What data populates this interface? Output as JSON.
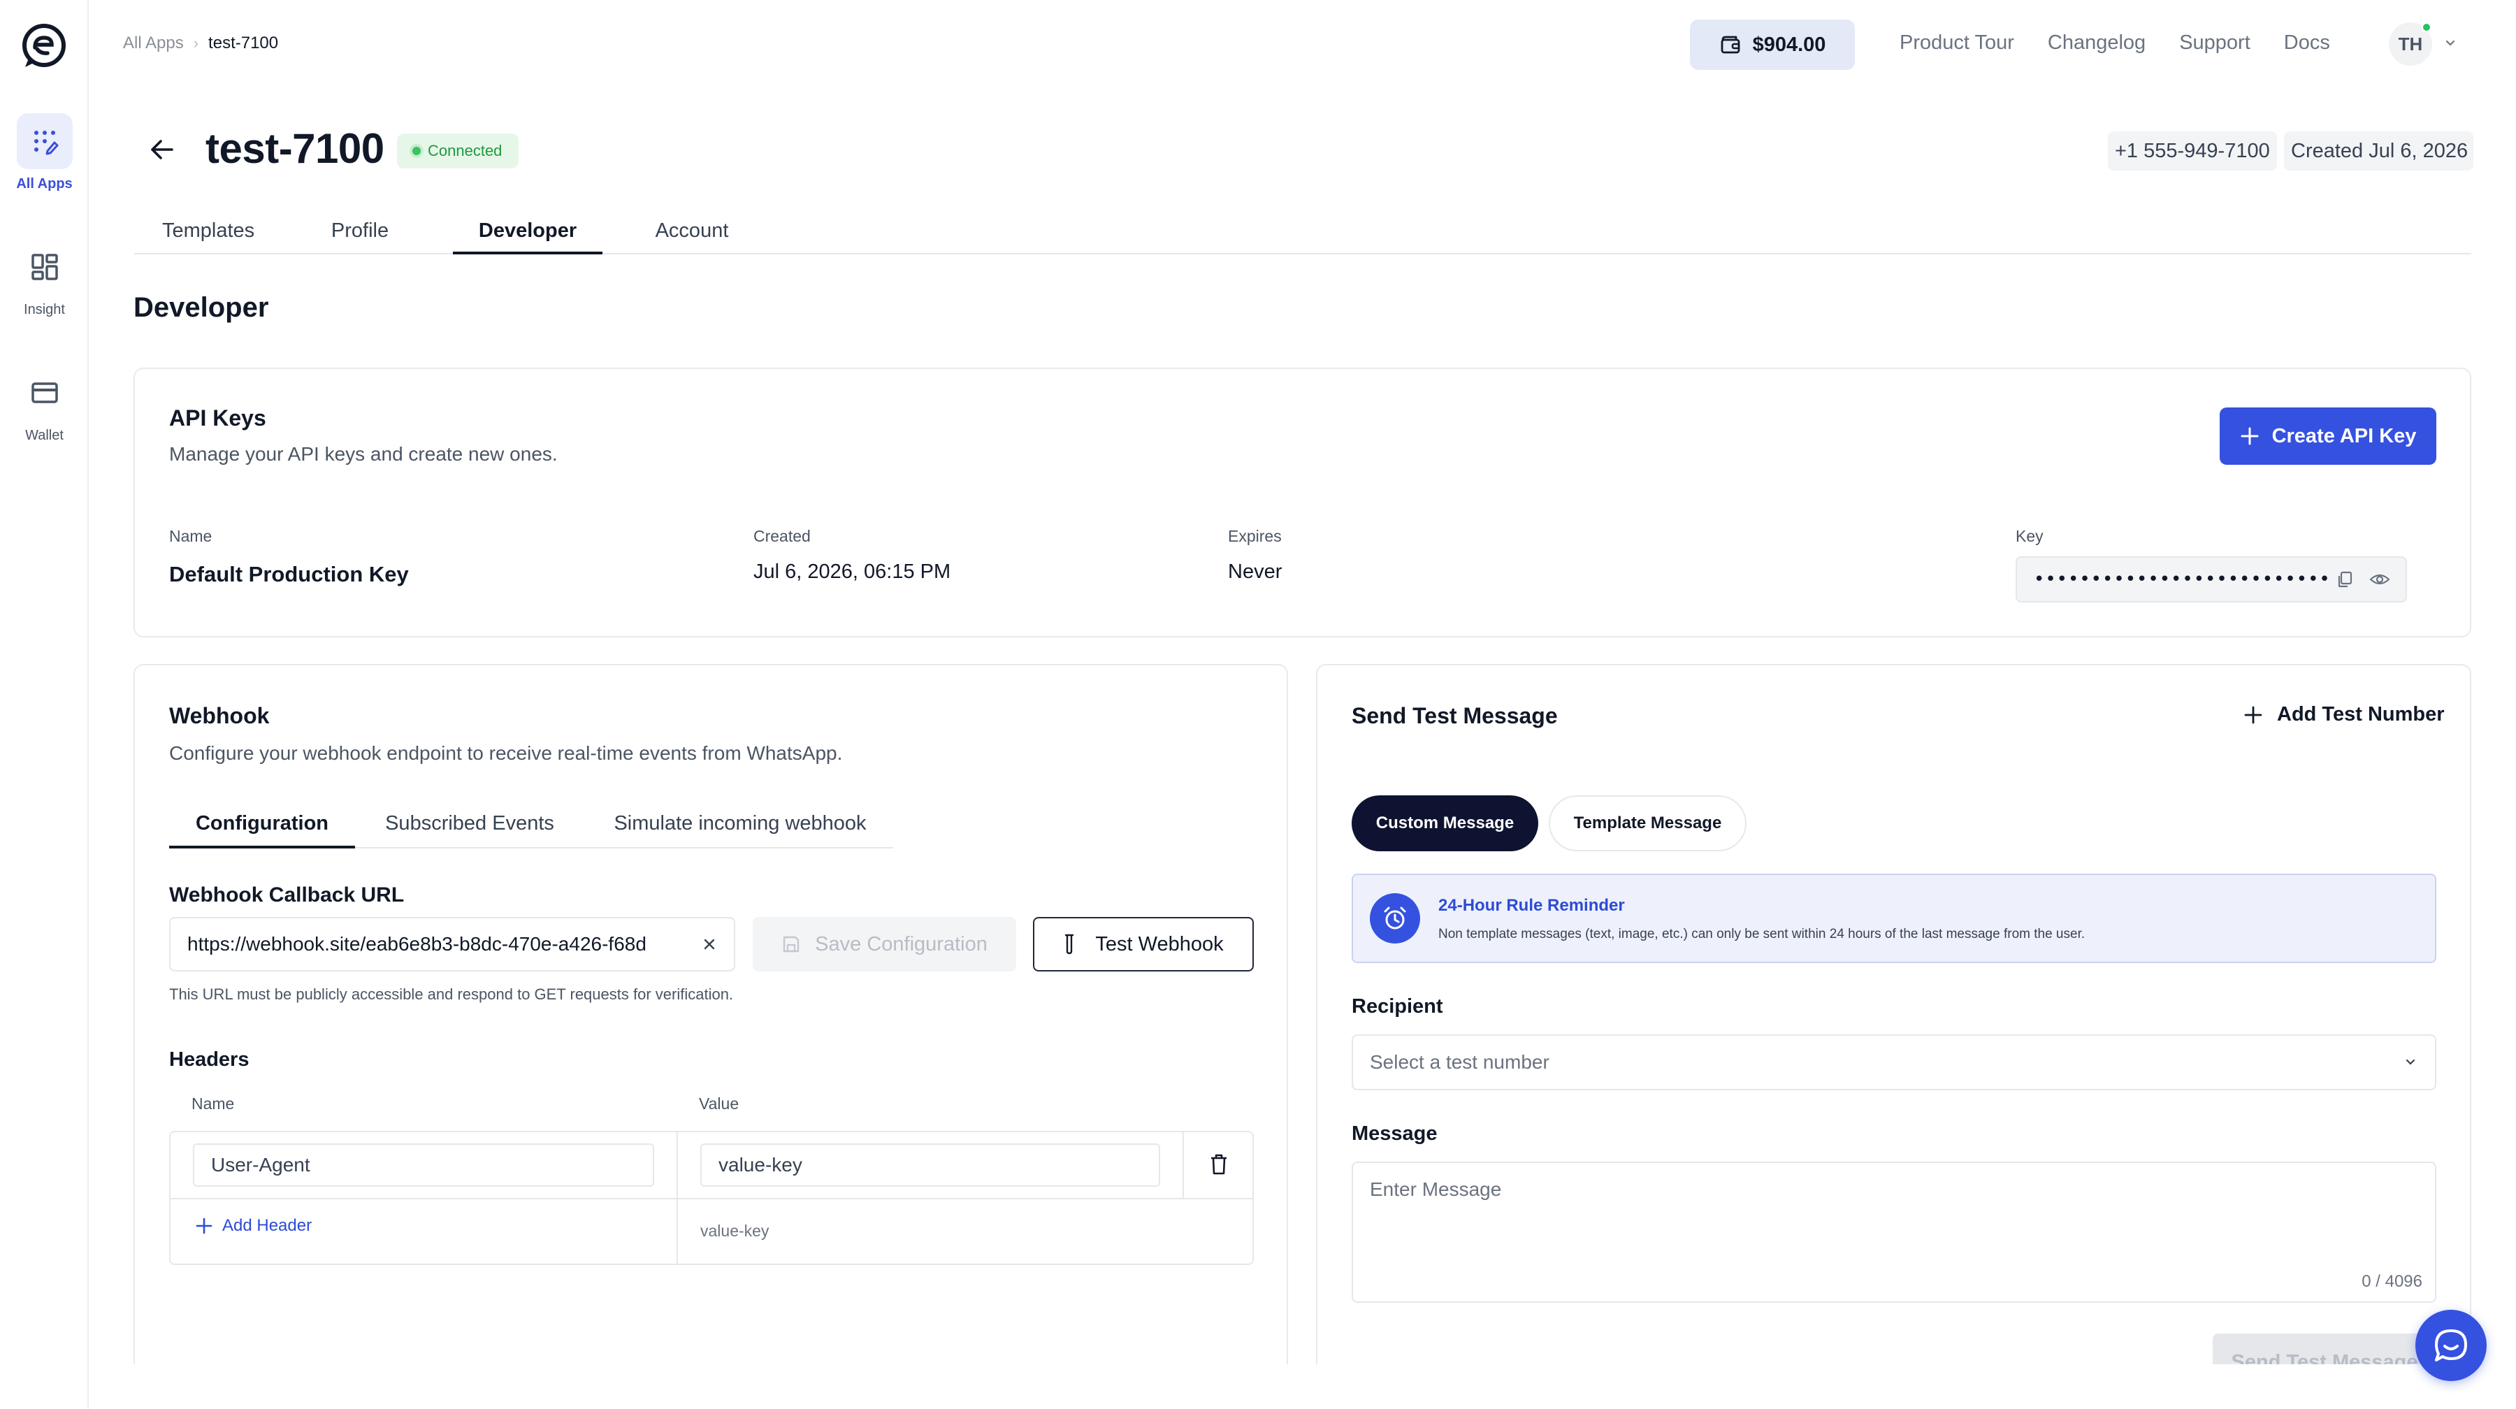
{
  "sidebar": {
    "items": [
      {
        "label": "All Apps",
        "icon": "apps-icon"
      },
      {
        "label": "Insight",
        "icon": "grid-icon"
      },
      {
        "label": "Wallet",
        "icon": "card-icon"
      }
    ]
  },
  "breadcrumb": {
    "parent": "All Apps",
    "current": "test-7100"
  },
  "topbar": {
    "balance": "$904.00",
    "links": [
      "Product Tour",
      "Changelog",
      "Support",
      "Docs"
    ],
    "avatar_initials": "TH"
  },
  "app": {
    "title": "test-7100",
    "status": "Connected",
    "phone": "+1 555-949-7100",
    "created": "Created Jul 6, 2026"
  },
  "tabs": [
    "Templates",
    "Profile",
    "Developer",
    "Account"
  ],
  "section_title": "Developer",
  "api_keys": {
    "title": "API Keys",
    "subtitle": "Manage your API keys and create new ones.",
    "create_label": "Create API Key",
    "columns": {
      "name": "Name",
      "created": "Created",
      "expires": "Expires",
      "key": "Key"
    },
    "row": {
      "name": "Default Production Key",
      "created": "Jul 6, 2026, 06:15 PM",
      "expires": "Never",
      "key_masked": "••••••••••••••••••••••••••"
    }
  },
  "webhook": {
    "title": "Webhook",
    "subtitle": "Configure your webhook endpoint to receive real-time events from WhatsApp.",
    "tabs": [
      "Configuration",
      "Subscribed Events",
      "Simulate incoming webhook"
    ],
    "url_label": "Webhook Callback URL",
    "url_value": "https://webhook.site/eab6e8b3-b8dc-470e-a426-f68d",
    "save_label": "Save Configuration",
    "test_label": "Test Webhook",
    "hint": "This URL must be publicly accessible and respond to GET requests for verification.",
    "headers_label": "Headers",
    "headers_columns": {
      "name": "Name",
      "value": "Value"
    },
    "header_row": {
      "name": "User-Agent",
      "value": "value-key"
    },
    "add_header_label": "Add Header",
    "new_value_placeholder": "value-key"
  },
  "test_message": {
    "title": "Send Test Message",
    "add_number_label": "Add Test Number",
    "pills": [
      "Custom Message",
      "Template Message"
    ],
    "reminder_title": "24-Hour Rule Reminder",
    "reminder_body": "Non template messages (text, image, etc.) can only be sent within 24 hours of the last message from the user.",
    "recipient_label": "Recipient",
    "recipient_placeholder": "Select a test number",
    "message_label": "Message",
    "message_placeholder": "Enter Message",
    "counter": "0 / 4096",
    "send_label": "Send Test Message"
  },
  "colors": {
    "accent": "#3551e0",
    "success": "#22973f",
    "dark_pill": "#0d1330"
  }
}
